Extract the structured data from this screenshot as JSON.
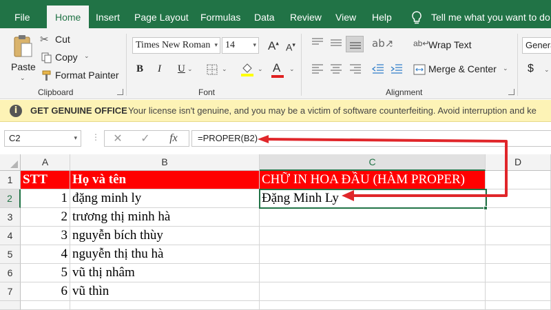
{
  "ribbon_tabs": [
    "File",
    "Home",
    "Insert",
    "Page Layout",
    "Formulas",
    "Data",
    "Review",
    "View",
    "Help"
  ],
  "tell_me": "Tell me what you want to do",
  "clipboard": {
    "paste": "Paste",
    "cut": "Cut",
    "copy": "Copy",
    "format_painter": "Format Painter",
    "label": "Clipboard"
  },
  "font": {
    "name": "Times New Roman",
    "size": "14",
    "label": "Font",
    "bold": "B",
    "italic": "I",
    "underline": "U"
  },
  "alignment": {
    "wrap_text": "Wrap Text",
    "merge_center": "Merge & Center",
    "label": "Alignment"
  },
  "number": {
    "format": "Genera",
    "currency": "$"
  },
  "message_bar": {
    "title": "GET GENUINE OFFICE",
    "text": "Your license isn't genuine, and you may be a victim of software counterfeiting. Avoid interruption and ke"
  },
  "formula_bar": {
    "name_box": "C2",
    "formula": "=PROPER(B2)",
    "fx": "fx"
  },
  "columns": [
    "A",
    "B",
    "C",
    "D"
  ],
  "rows": [
    "1",
    "2",
    "3",
    "4",
    "5",
    "6",
    "7"
  ],
  "sheet": {
    "header": {
      "a": "STT",
      "b": "Họ và tên",
      "c": "CHỮ IN HOA ĐẦU (HÀM PROPER)"
    },
    "data": [
      {
        "a": "1",
        "b": "đặng minh ly",
        "c": "Đặng Minh Ly"
      },
      {
        "a": "2",
        "b": "trương thị minh hà",
        "c": ""
      },
      {
        "a": "3",
        "b": "nguyễn bích thùy",
        "c": ""
      },
      {
        "a": "4",
        "b": "nguyễn thị thu hà",
        "c": ""
      },
      {
        "a": "5",
        "b": "vũ thị nhâm",
        "c": ""
      },
      {
        "a": "6",
        "b": "vũ thìn",
        "c": ""
      }
    ]
  },
  "colors": {
    "excel_green": "#217346",
    "header_red": "#ff0000",
    "arrow_red": "#e0262a",
    "message_bar": "#fdf3b6"
  },
  "active_cell": "C2"
}
